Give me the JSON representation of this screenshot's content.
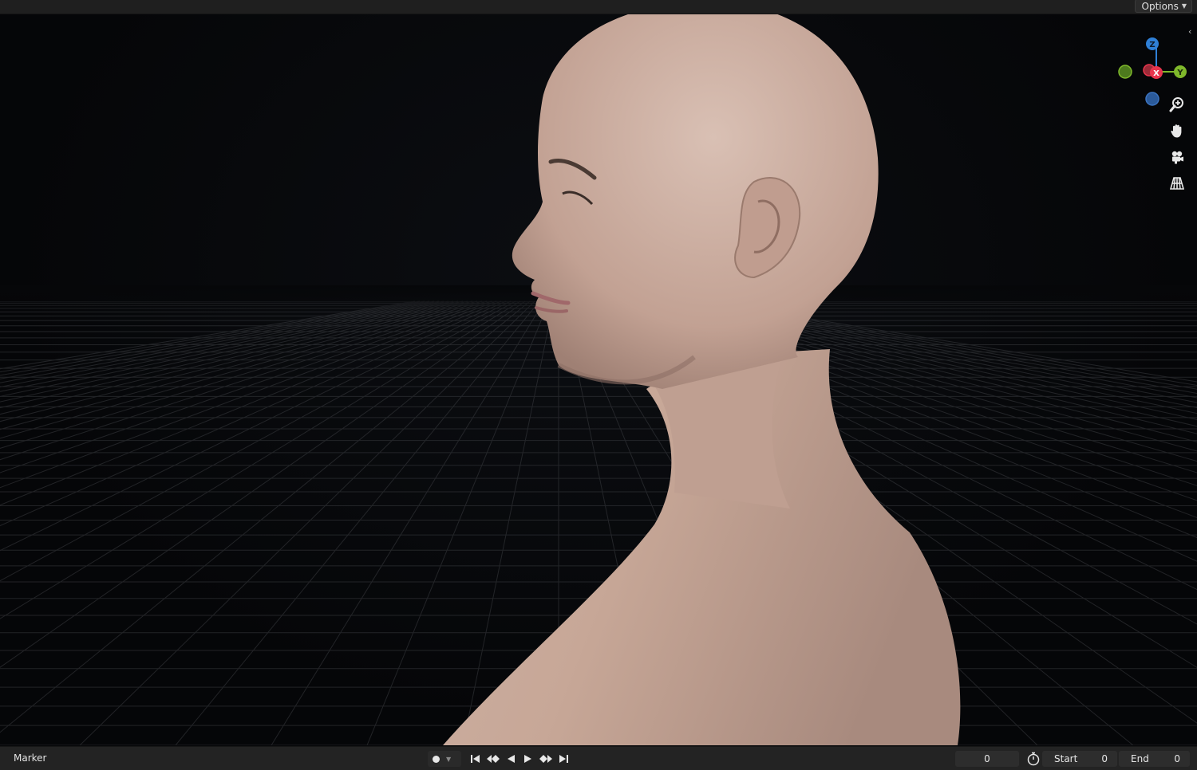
{
  "header": {
    "options_label": "Options"
  },
  "gizmo": {
    "axis_z": "Z",
    "axis_x": "X",
    "axis_y": "Y",
    "colors": {
      "x": "#e8354d",
      "y": "#7fb82b",
      "z": "#2f7fd6",
      "neg_x": "#9a2b38",
      "neg_y": "#4d7a1e",
      "neg_z": "#2b5a9a"
    }
  },
  "nav_tools": [
    {
      "icon": "zoom-icon"
    },
    {
      "icon": "pan-hand-icon"
    },
    {
      "icon": "camera-view-icon"
    },
    {
      "icon": "perspective-grid-icon"
    }
  ],
  "timeline": {
    "marker_label": "Marker",
    "current_frame": "0",
    "start_label": "Start",
    "start_value": "0",
    "end_label": "End",
    "end_value": "0",
    "transport_icons": [
      "jump-start-icon",
      "prev-keyframe-icon",
      "play-reverse-icon",
      "play-icon",
      "next-keyframe-icon",
      "jump-end-icon"
    ]
  }
}
